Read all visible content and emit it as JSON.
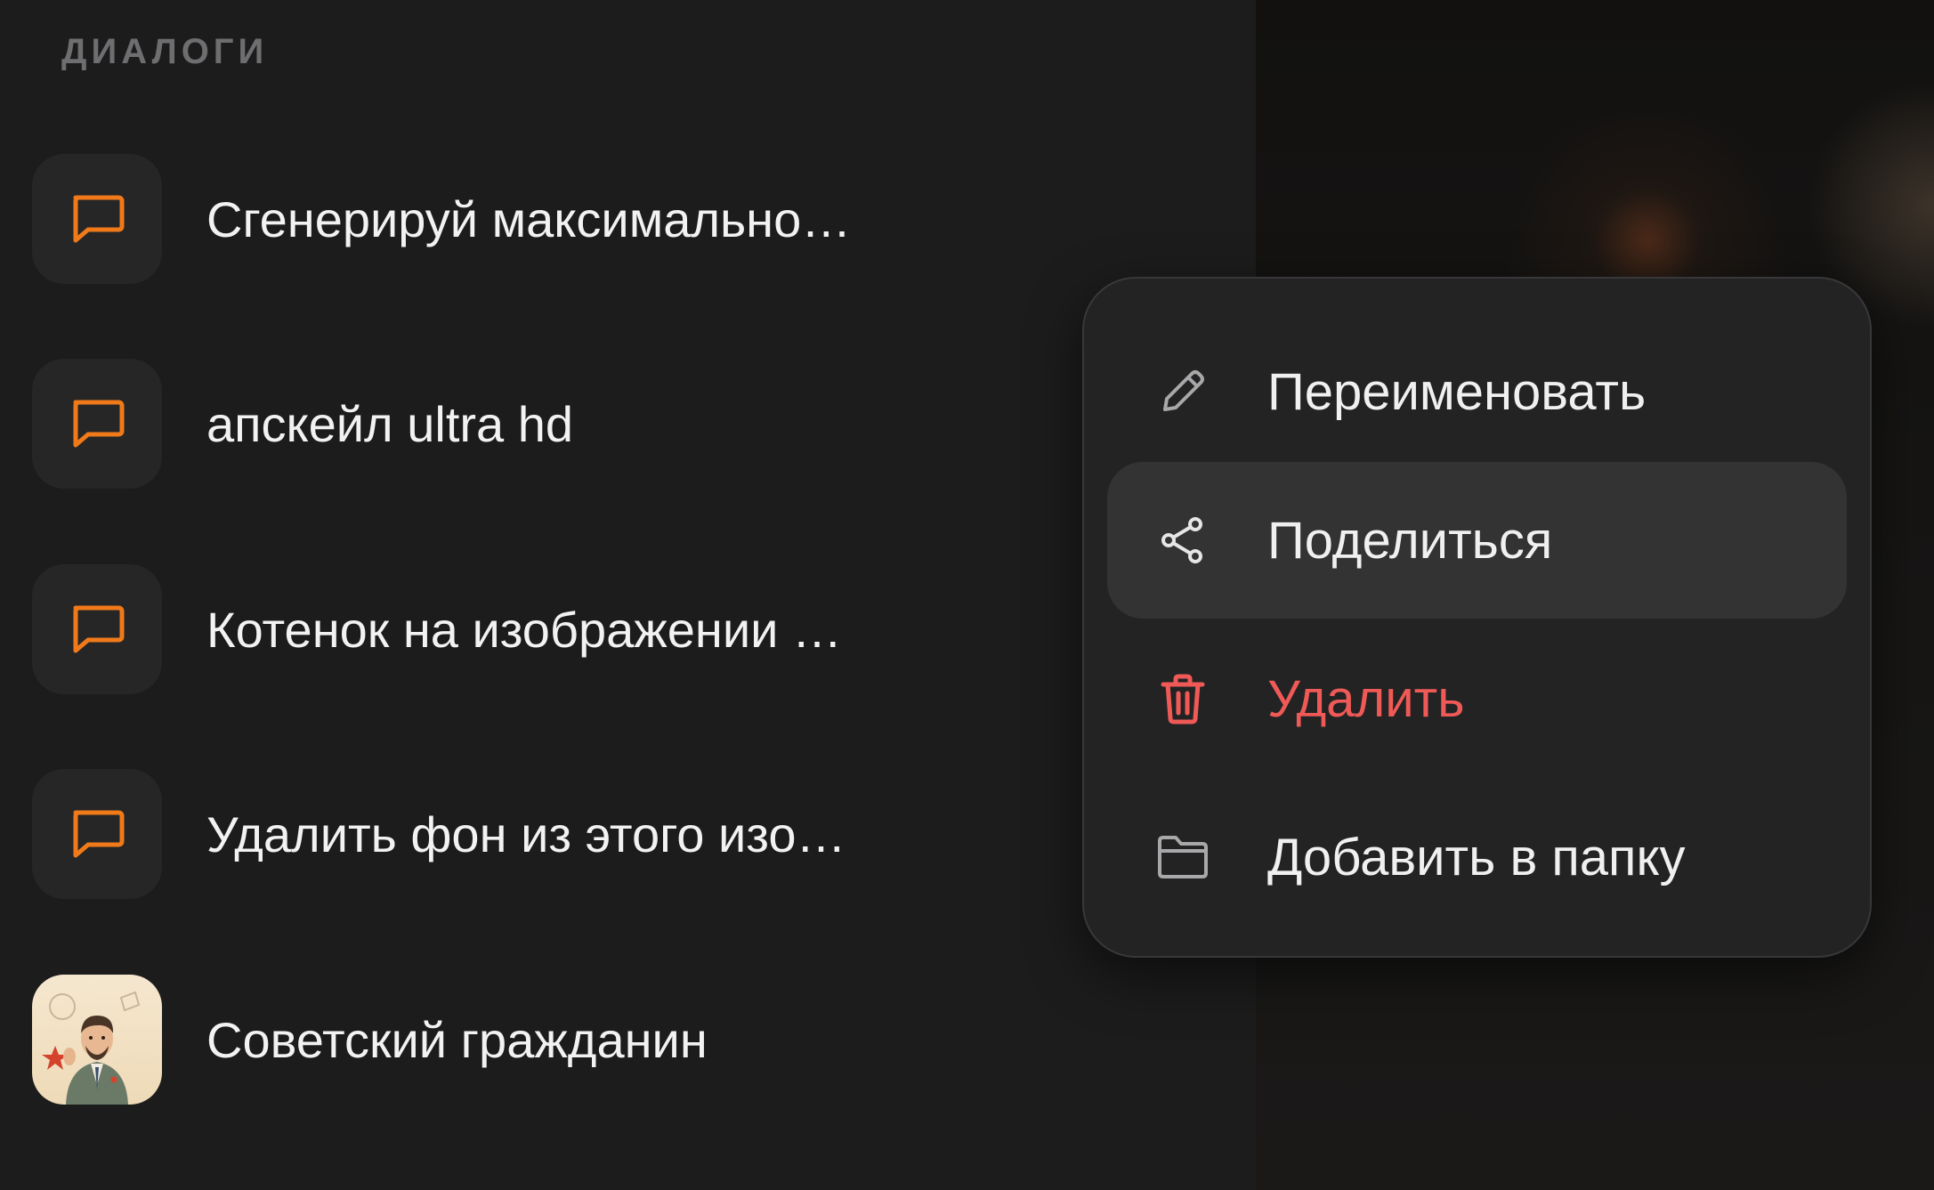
{
  "sidebar": {
    "section_title": "ДИАЛОГИ",
    "items": [
      {
        "label": "Сгенерируй максимально…",
        "icon": "chat-bubble-icon"
      },
      {
        "label": "апскейл ultra hd",
        "icon": "chat-bubble-icon"
      },
      {
        "label": "Котенок на изображении …",
        "icon": "chat-bubble-icon"
      },
      {
        "label": "Удалить фон из этого изо…",
        "icon": "chat-bubble-icon"
      },
      {
        "label": "Советский гражданин",
        "icon": "character-avatar"
      }
    ]
  },
  "context_menu": {
    "items": [
      {
        "label": "Переименовать",
        "icon": "pencil-icon"
      },
      {
        "label": "Поделиться",
        "icon": "share-icon",
        "highlighted": true
      },
      {
        "label": "Удалить",
        "icon": "trash-icon",
        "danger": true
      },
      {
        "label": "Добавить в папку",
        "icon": "folder-icon"
      }
    ]
  },
  "colors": {
    "accent": "#f07a1a",
    "danger": "#ef5a57",
    "background": "#1c1c1d",
    "menu_background": "#232324",
    "highlight": "#333334"
  }
}
